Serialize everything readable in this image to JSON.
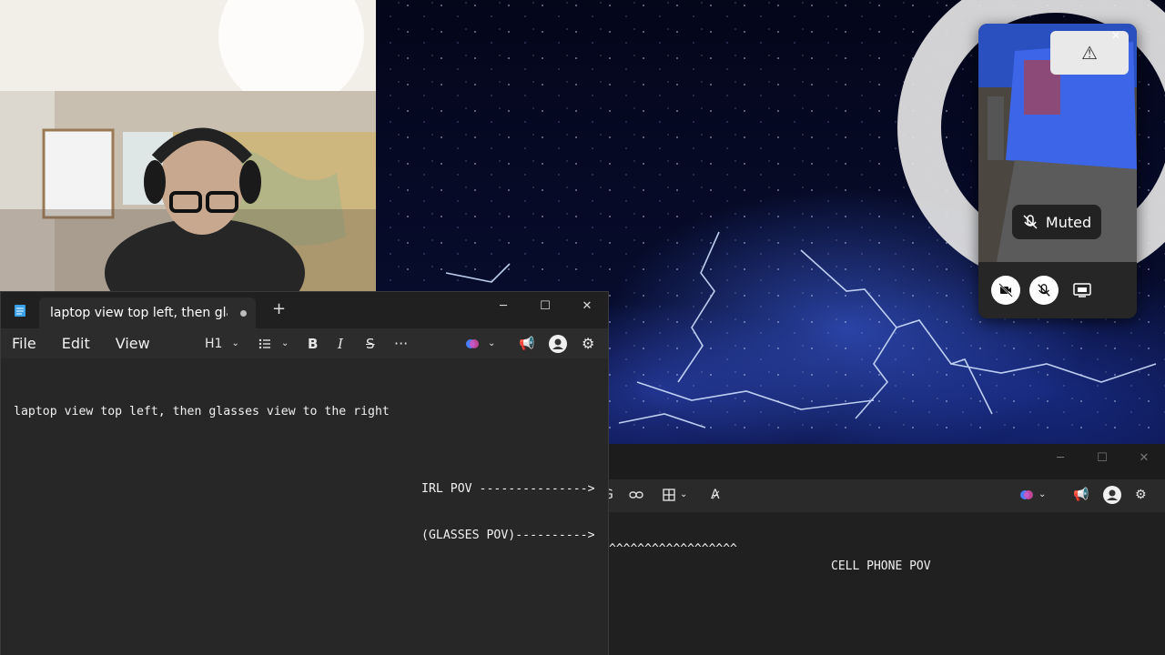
{
  "notepad_main": {
    "tab_title": "laptop view top left, then glasses view to the right",
    "new_tab_symbol": "+",
    "menu": [
      "File",
      "Edit",
      "View"
    ],
    "heading_style": "H1",
    "body_text": "laptop view top left, then glasses view to the right",
    "pov_lines": [
      "IRL POV --------------->",
      "(GLASSES POV)---------->"
    ]
  },
  "notepad_back": {
    "line_carets": "^^^^^^^^^^^^^^^^^^",
    "line_cell": "CELL PHONE POV"
  },
  "phone_overlay": {
    "muted_label": "Muted",
    "warning_glyph": "⚠"
  },
  "colors": {
    "accent": "#4a7dff",
    "window_bg": "#272727",
    "titlebar_bg": "#202020"
  }
}
